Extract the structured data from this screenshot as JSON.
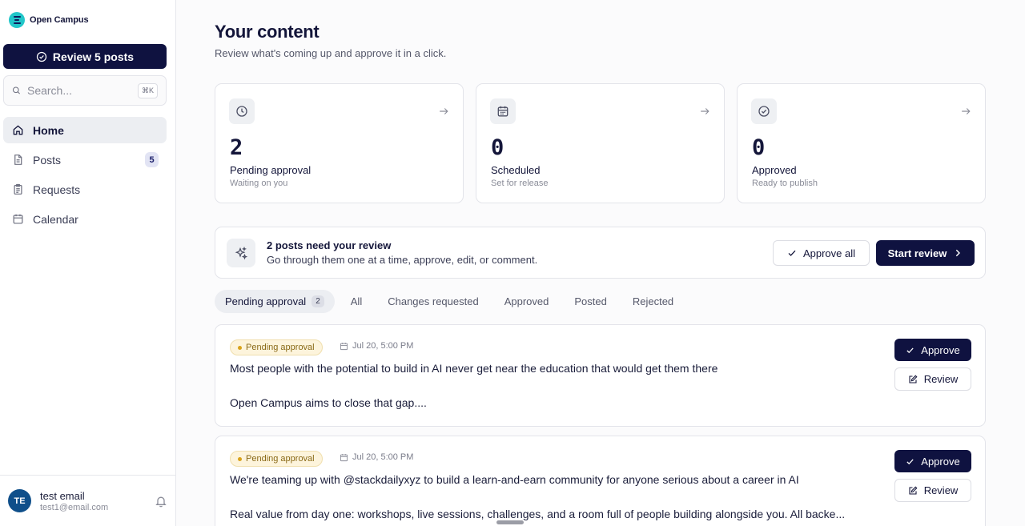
{
  "brand": {
    "name": "Open Campus",
    "logo_icon": "open-campus-logo"
  },
  "sidebar": {
    "review_button": "Review 5 posts",
    "search": {
      "placeholder": "Search...",
      "shortcut": "⌘K"
    },
    "items": [
      {
        "label": "Home",
        "icon": "home-icon",
        "active": true
      },
      {
        "label": "Posts",
        "icon": "document-icon",
        "badge": "5"
      },
      {
        "label": "Requests",
        "icon": "clipboard-icon"
      },
      {
        "label": "Calendar",
        "icon": "calendar-icon"
      }
    ],
    "user": {
      "initials": "TE",
      "name": "test email",
      "email": "test1@email.com"
    }
  },
  "main": {
    "title": "Your content",
    "subtitle": "Review what's coming up and approve it in a click.",
    "stats": [
      {
        "value": "2",
        "label": "Pending approval",
        "sub": "Waiting on you",
        "icon": "clock-icon"
      },
      {
        "value": "0",
        "label": "Scheduled",
        "sub": "Set for release",
        "icon": "calendar-icon"
      },
      {
        "value": "0",
        "label": "Approved",
        "sub": "Ready to publish",
        "icon": "check-circle-icon"
      }
    ],
    "banner": {
      "title": "2 posts need your review",
      "subtitle": "Go through them one at a time, approve, edit, or comment.",
      "approve_all": "Approve all",
      "start_review": "Start review"
    },
    "tabs": [
      {
        "label": "Pending approval",
        "count": "2",
        "active": true
      },
      {
        "label": "All"
      },
      {
        "label": "Changes requested"
      },
      {
        "label": "Approved"
      },
      {
        "label": "Posted"
      },
      {
        "label": "Rejected"
      }
    ],
    "posts": [
      {
        "status": "Pending approval",
        "date": "Jul 20, 5:00 PM",
        "line1": "Most people with the potential to build in AI never get near the education that would get them there",
        "line2": "Open Campus aims to close that gap....",
        "approve": "Approve",
        "review": "Review"
      },
      {
        "status": "Pending approval",
        "date": "Jul 20, 5:00 PM",
        "line1": "We're teaming up with @stackdailyxyz to build a learn-and-earn community for anyone serious about a career in AI",
        "line2": "Real value from day one: workshops, live sessions, challenges, and a room full of people building alongside you. All backe...",
        "approve": "Approve",
        "review": "Review"
      }
    ]
  },
  "colors": {
    "primary": "#0f1240",
    "accent": "#22c6c9",
    "pending_bg": "#fdf4dc",
    "pending_text": "#8a6a18"
  }
}
